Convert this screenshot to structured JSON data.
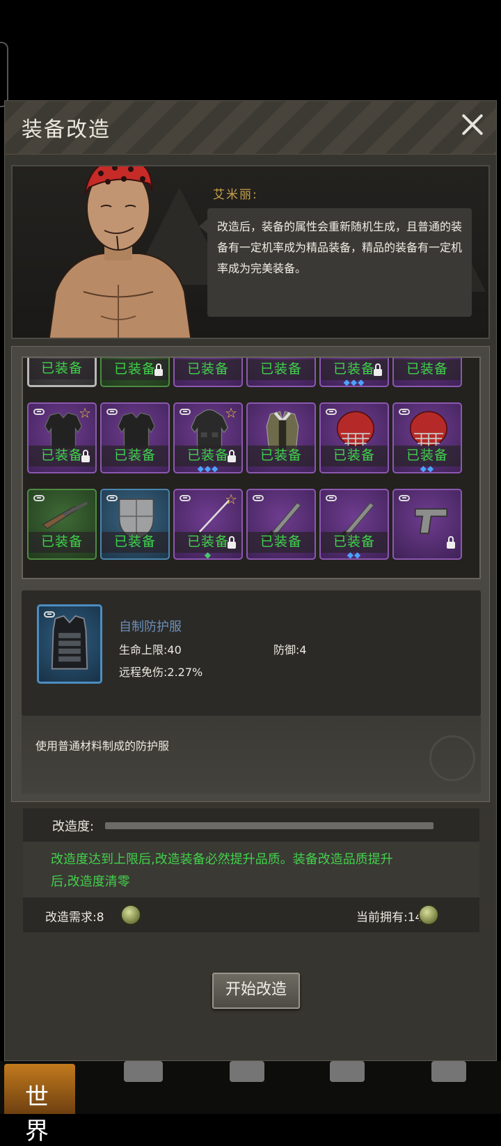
{
  "window": {
    "title": "装备改造"
  },
  "npc": {
    "name": "艾米丽:",
    "dialogue": "改造后，装备的属性会重新随机生成，且普通的装备有一定机率成为精品装备，精品的装备有一定机率成为完美装备。"
  },
  "equipped_label": "已装备",
  "grid": {
    "rows": [
      [
        {
          "rarity": "gray",
          "equipped": true,
          "lock": false,
          "star": false,
          "link": false,
          "gems": ""
        },
        {
          "rarity": "green",
          "equipped": true,
          "lock": true,
          "star": false,
          "link": false,
          "gems": ""
        },
        {
          "rarity": "purple",
          "equipped": true,
          "lock": false,
          "star": false,
          "link": false,
          "gems": ""
        },
        {
          "rarity": "purple",
          "equipped": true,
          "lock": false,
          "star": false,
          "link": false,
          "gems": ""
        },
        {
          "rarity": "purple",
          "equipped": true,
          "lock": true,
          "star": false,
          "link": false,
          "gems": "◆◆◆"
        },
        {
          "rarity": "purple",
          "equipped": true,
          "lock": false,
          "star": false,
          "link": false,
          "gems": ""
        }
      ],
      [
        {
          "rarity": "purple",
          "equipped": true,
          "lock": true,
          "star": true,
          "link": true,
          "gems": "",
          "art": "jacket"
        },
        {
          "rarity": "purple",
          "equipped": true,
          "lock": false,
          "star": false,
          "link": true,
          "gems": "",
          "art": "jacket"
        },
        {
          "rarity": "purple",
          "equipped": true,
          "lock": true,
          "star": true,
          "link": true,
          "gems": "◆◆◆",
          "art": "hoodie"
        },
        {
          "rarity": "purple",
          "equipped": true,
          "lock": false,
          "star": false,
          "link": false,
          "gems": "",
          "art": "coat"
        },
        {
          "rarity": "purple",
          "equipped": true,
          "lock": false,
          "star": false,
          "link": true,
          "gems": "",
          "art": "helmet"
        },
        {
          "rarity": "purple",
          "equipped": true,
          "lock": false,
          "star": false,
          "link": true,
          "gems": "◆◆",
          "art": "helmet"
        }
      ],
      [
        {
          "rarity": "green",
          "equipped": true,
          "lock": false,
          "star": false,
          "link": true,
          "gems": "",
          "art": "shotgun"
        },
        {
          "rarity": "blue",
          "equipped": true,
          "lock": false,
          "star": false,
          "link": true,
          "gems": "",
          "art": "shield"
        },
        {
          "rarity": "purple",
          "equipped": true,
          "lock": true,
          "star": true,
          "link": true,
          "gems": "◆",
          "gemColor": "green",
          "art": "katana"
        },
        {
          "rarity": "purple",
          "equipped": true,
          "lock": false,
          "star": false,
          "link": true,
          "gems": "",
          "art": "machete"
        },
        {
          "rarity": "purple",
          "equipped": true,
          "lock": false,
          "star": false,
          "link": true,
          "gems": "◆◆",
          "art": "machete"
        },
        {
          "rarity": "purple",
          "equipped": false,
          "lock": true,
          "star": false,
          "link": true,
          "gems": "",
          "art": "pistol"
        }
      ]
    ]
  },
  "detail": {
    "name": "自制防护服",
    "hp_label": "生命上限:40",
    "def_label": "防御:4",
    "ranged_label": "远程免伤:2.27%",
    "description": "使用普通材料制成的防护服"
  },
  "modify": {
    "degree_label": "改造度:",
    "degree_value": 0,
    "note": "改造度达到上限后,改造装备必然提升品质。装备改造品质提升后,改造度清零",
    "requirement_label": "改造需求:8",
    "owned_label": "当前拥有:1466",
    "start_button": "开始改造"
  },
  "nav": {
    "world": "世界"
  }
}
